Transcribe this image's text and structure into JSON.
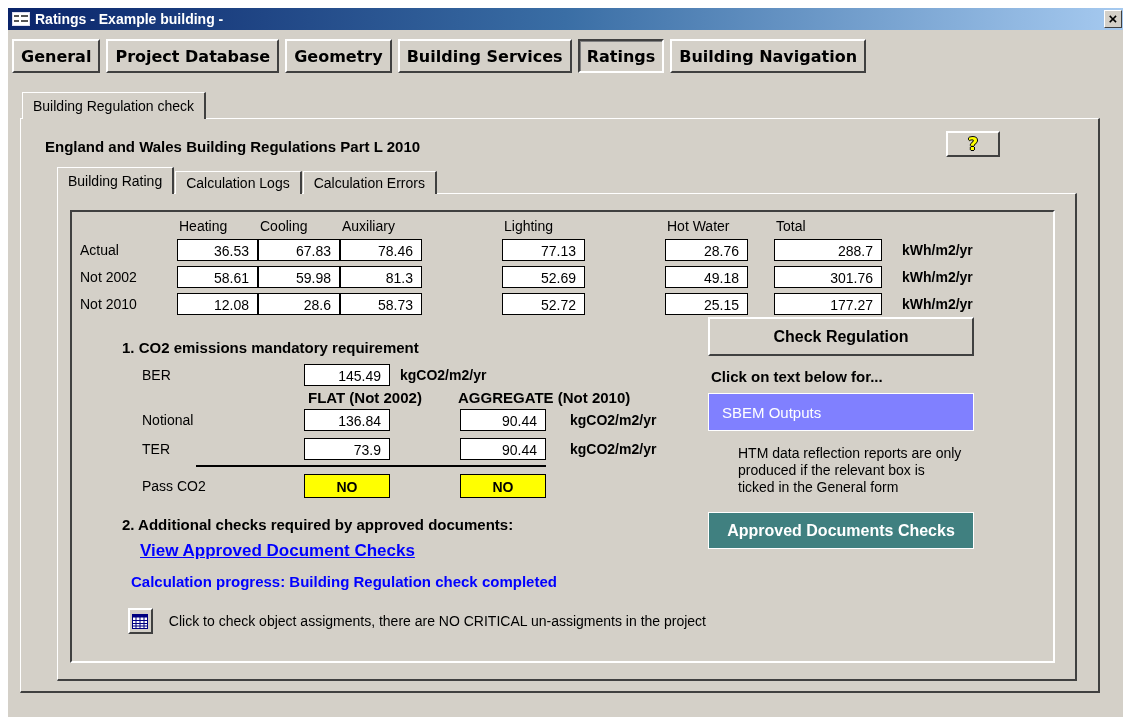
{
  "window": {
    "title": "Ratings - Example building -",
    "close": "×"
  },
  "tabs": [
    {
      "label": "General",
      "selected": false
    },
    {
      "label": "Project Database",
      "selected": false
    },
    {
      "label": "Geometry",
      "selected": false
    },
    {
      "label": "Building Services",
      "selected": false
    },
    {
      "label": "Ratings",
      "selected": true
    },
    {
      "label": "Building Navigation",
      "selected": false
    }
  ],
  "section_tabs": [
    {
      "label": "Building Regulation check",
      "selected": true
    }
  ],
  "heading": "England and Wales Building Regulations Part L 2010",
  "help_button": {
    "label": "?"
  },
  "sub_tabs": [
    {
      "label": "Building Rating",
      "selected": true
    },
    {
      "label": "Calculation Logs",
      "selected": false
    },
    {
      "label": "Calculation Errors",
      "selected": false
    }
  ],
  "energy": {
    "columns": [
      "Heating",
      "Cooling",
      "Auxiliary",
      "Lighting",
      "Hot Water",
      "Total"
    ],
    "rows": [
      {
        "label": "Actual",
        "values": [
          "36.53",
          "67.83",
          "78.46",
          "77.13",
          "28.76",
          "288.7"
        ],
        "unit": "kWh/m2/yr"
      },
      {
        "label": "Not 2002",
        "values": [
          "58.61",
          "59.98",
          "81.3",
          "52.69",
          "49.18",
          "301.76"
        ],
        "unit": "kWh/m2/yr"
      },
      {
        "label": "Not 2010",
        "values": [
          "12.08",
          "28.6",
          "58.73",
          "52.72",
          "25.15",
          "177.27"
        ],
        "unit": "kWh/m2/yr"
      }
    ]
  },
  "co2": {
    "title": "1. CO2 emissions mandatory requirement",
    "ber": {
      "label": "BER",
      "value": "145.49",
      "unit": "kgCO2/m2/yr"
    },
    "columns": [
      "FLAT (Not 2002)",
      "AGGREGATE (Not 2010)"
    ],
    "rows": [
      {
        "label": "Notional",
        "values": [
          "136.84",
          "90.44"
        ],
        "unit": "kgCO2/m2/yr"
      },
      {
        "label": "TER",
        "values": [
          "73.9",
          "90.44"
        ],
        "unit": "kgCO2/m2/yr"
      }
    ],
    "pass": {
      "label": "Pass CO2",
      "values": [
        "NO",
        "NO"
      ]
    }
  },
  "additional": {
    "title": "2. Additional checks required by approved documents:",
    "link": "View Approved Document Checks"
  },
  "progress": "Calculation progress: Building Regulation check completed",
  "assignments": "Click to check object assigments, there are NO CRITICAL un-assigments in the project",
  "check_button": "Check Regulation",
  "click_hint": "Click on text below for...",
  "sbem_outputs": "SBEM Outputs",
  "htm_note": "HTM data reflection reports are only produced if the relevant box is ticked in the General form",
  "approved_button": "Approved Documents Checks"
}
